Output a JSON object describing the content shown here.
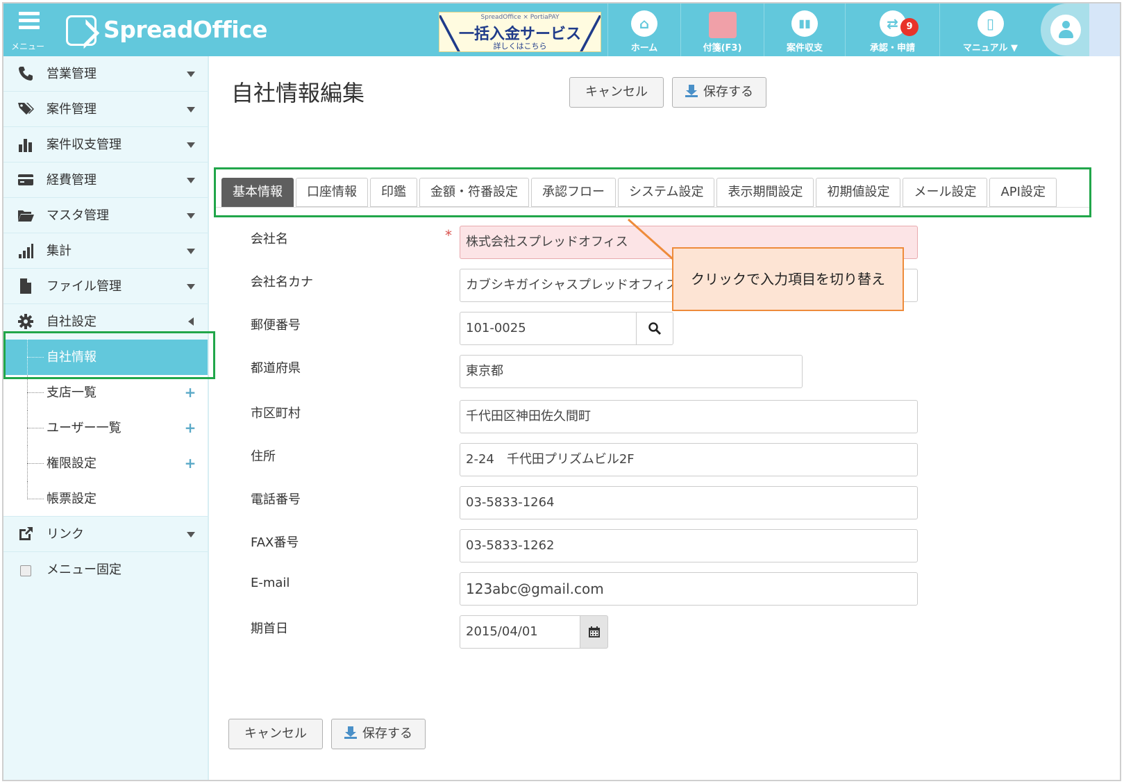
{
  "header": {
    "menu_label": "メニュー",
    "logo_text": "SpreadOffice",
    "banner": {
      "top": "SpreadOffice × PortiaPAY",
      "main": "一括入金サービス",
      "sub": "詳しくはこちら"
    },
    "nav": {
      "home": "ホーム",
      "fusen": "付箋(F3)",
      "shushi": "案件収支",
      "shonin": "承認・申請",
      "shonin_badge": "9",
      "manual": "マニュアル ▼"
    }
  },
  "sidebar": {
    "items": [
      {
        "label": "営業管理",
        "icon": "phone-icon"
      },
      {
        "label": "案件管理",
        "icon": "tag-icon"
      },
      {
        "label": "案件収支管理",
        "icon": "bar-chart-icon"
      },
      {
        "label": "経費管理",
        "icon": "credit-card-icon"
      },
      {
        "label": "マスタ管理",
        "icon": "folder-open-icon"
      },
      {
        "label": "集計",
        "icon": "signal-icon"
      },
      {
        "label": "ファイル管理",
        "icon": "file-icon"
      },
      {
        "label": "自社設定",
        "icon": "gear-icon"
      }
    ],
    "sub_items": [
      {
        "label": "自社情報"
      },
      {
        "label": "支店一覧",
        "plus": "+"
      },
      {
        "label": "ユーザー一覧",
        "plus": "+"
      },
      {
        "label": "権限設定",
        "plus": "+"
      },
      {
        "label": "帳票設定"
      }
    ],
    "link": "リンク",
    "menu_fix": "メニュー固定"
  },
  "main": {
    "title": "自社情報編集",
    "cancel_label": "キャンセル",
    "save_label": "保存する",
    "tabs": [
      "基本情報",
      "口座情報",
      "印鑑",
      "金額・符番設定",
      "承認フロー",
      "システム設定",
      "表示期間設定",
      "初期値設定",
      "メール設定",
      "API設定"
    ],
    "active_tab": "基本情報",
    "form": {
      "company_name": {
        "label": "会社名",
        "required": "*",
        "value": "株式会社スプレッドオフィス"
      },
      "company_kana": {
        "label": "会社名カナ",
        "value": "カブシキガイシャスプレッドオフィス"
      },
      "postal": {
        "label": "郵便番号",
        "value": "101-0025"
      },
      "prefecture": {
        "label": "都道府県",
        "value": "東京都"
      },
      "city": {
        "label": "市区町村",
        "value": "千代田区神田佐久間町"
      },
      "address": {
        "label": "住所",
        "value": "2-24　千代田プリズムビル2F"
      },
      "tel": {
        "label": "電話番号",
        "value": "03-5833-1264"
      },
      "fax": {
        "label": "FAX番号",
        "value": "03-5833-1262"
      },
      "email": {
        "label": "E-mail",
        "value": "123abc@gmail.com"
      },
      "fiscal_start": {
        "label": "期首日",
        "value": "2015/04/01"
      }
    },
    "callout": "クリックで入力項目を切り替え"
  },
  "colors": {
    "header_bg": "#62c8dc",
    "sidebar_bg": "#eaf8fb",
    "active_tab": "#5e5e5e",
    "highlight": "#21a64a",
    "callout_border": "#ee8b3a",
    "callout_bg": "#fde4d4",
    "required": "#d9534f"
  }
}
